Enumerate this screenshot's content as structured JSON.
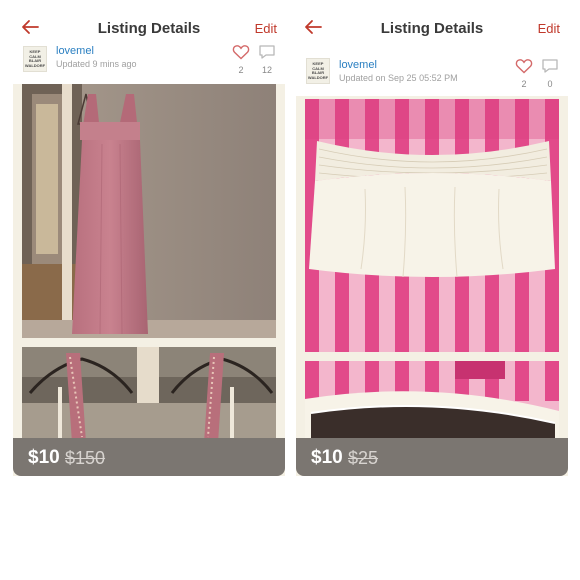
{
  "panels": [
    {
      "title": "Listing Details",
      "edit_label": "Edit",
      "username": "lovemel",
      "avatar_text": "KEEP CALM BLAIR WALDORF",
      "updated": "Updated 9 mins ago",
      "likes": "2",
      "comments": "12",
      "price": "$10",
      "original_price": "$150"
    },
    {
      "title": "Listing Details",
      "edit_label": "Edit",
      "username": "lovemel",
      "avatar_text": "KEEP CALM BLAIR WALDORF",
      "updated": "Updated on Sep 25 05:52 PM",
      "likes": "2",
      "comments": "0",
      "price": "$10",
      "original_price": "$25"
    }
  ],
  "colors": {
    "accent_red": "#c0392b",
    "username_blue": "#2a7fc1",
    "price_bar": "#7b7671"
  },
  "icons": {
    "back": "arrow-left-icon",
    "like": "heart-icon",
    "comment": "speech-bubble-icon"
  }
}
